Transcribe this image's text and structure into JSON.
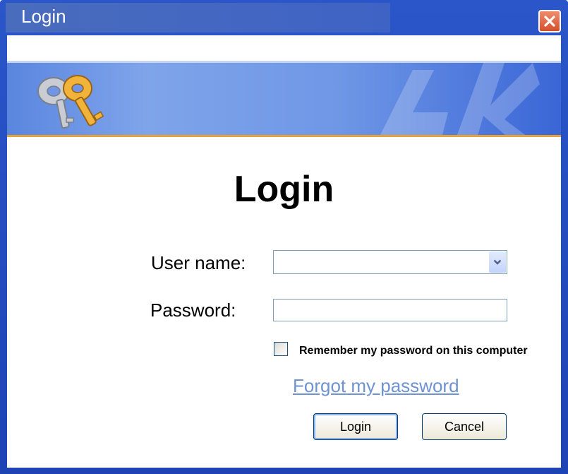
{
  "window": {
    "title": "Login"
  },
  "icons": {
    "close": "close-icon",
    "keys": "keys-icon",
    "dropdown": "chevron-down-icon"
  },
  "form": {
    "heading": "Login",
    "username_label": "User name:",
    "username_value": "",
    "password_label": "Password:",
    "password_value": "",
    "remember_label": "Remember my password on this computer",
    "remember_checked": false,
    "forgot_link": "Forgot my password"
  },
  "buttons": {
    "login": "Login",
    "cancel": "Cancel"
  },
  "colors": {
    "titlebar": "#2a56c9",
    "close": "#d5502c",
    "link": "#6f93d2",
    "banner_accent": "#e8a23a"
  }
}
